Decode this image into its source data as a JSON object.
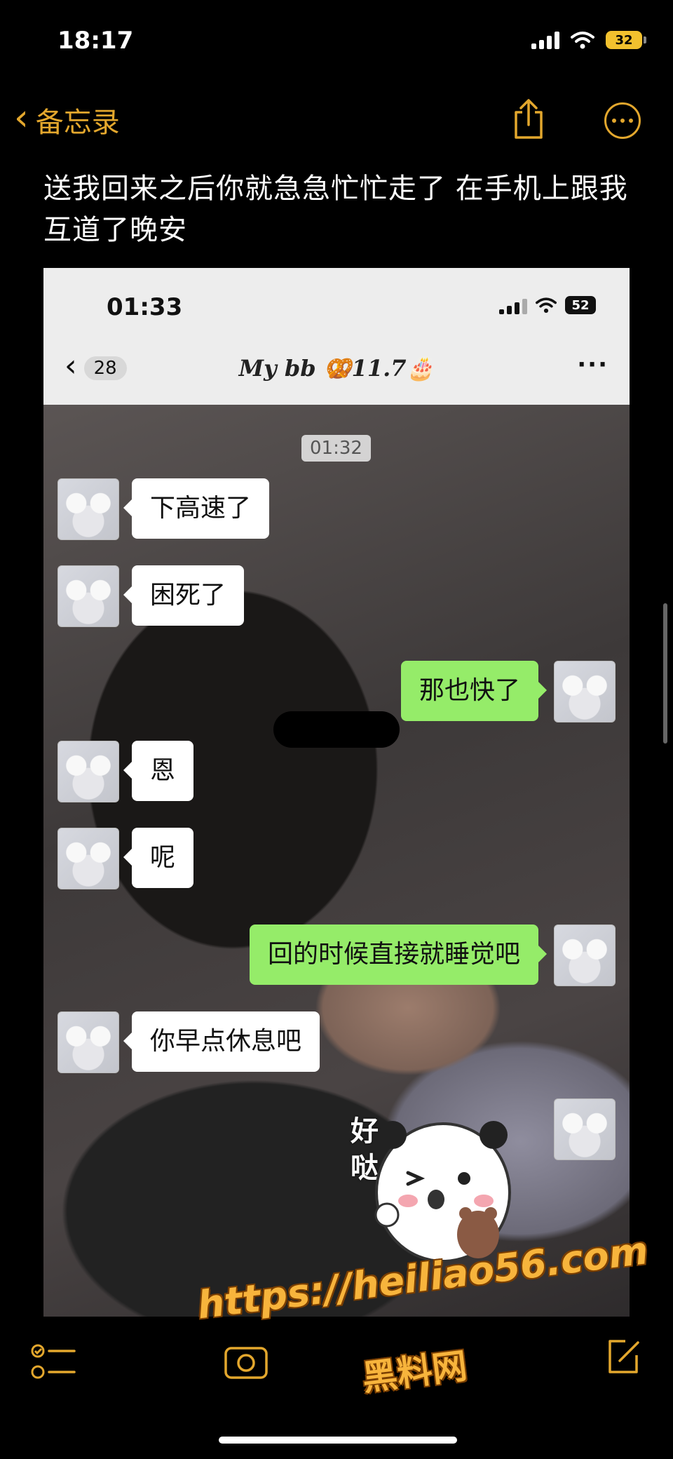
{
  "status_bar": {
    "time": "18:17",
    "battery": "32"
  },
  "nav": {
    "back_label": "备忘录"
  },
  "note": {
    "body": "送我回来之后你就急急忙忙走了 在手机上跟我互道了晚安"
  },
  "screenshot": {
    "status": {
      "time": "01:33",
      "battery": "52"
    },
    "chat_header": {
      "unread_count": "28",
      "title": "My bb 🥨11.7🎂",
      "more": "···"
    },
    "timestamp": "01:32",
    "messages": [
      {
        "side": "in",
        "text": "下高速了"
      },
      {
        "side": "in",
        "text": "困死了"
      },
      {
        "side": "out",
        "text": "那也快了"
      },
      {
        "side": "in",
        "text": "恩"
      },
      {
        "side": "in",
        "text": "呢"
      },
      {
        "side": "out",
        "text": "回的时候直接就睡觉吧"
      },
      {
        "side": "in",
        "text": "你早点休息吧"
      }
    ],
    "sticker_text": "好哒"
  },
  "watermark": {
    "url": "https://heiliao56.com",
    "name": "黑料网"
  },
  "colors": {
    "accent": "#e3a72d",
    "bubble_out": "#95ec69",
    "bubble_in": "#ffffff",
    "watermark": "#f7b43c"
  }
}
